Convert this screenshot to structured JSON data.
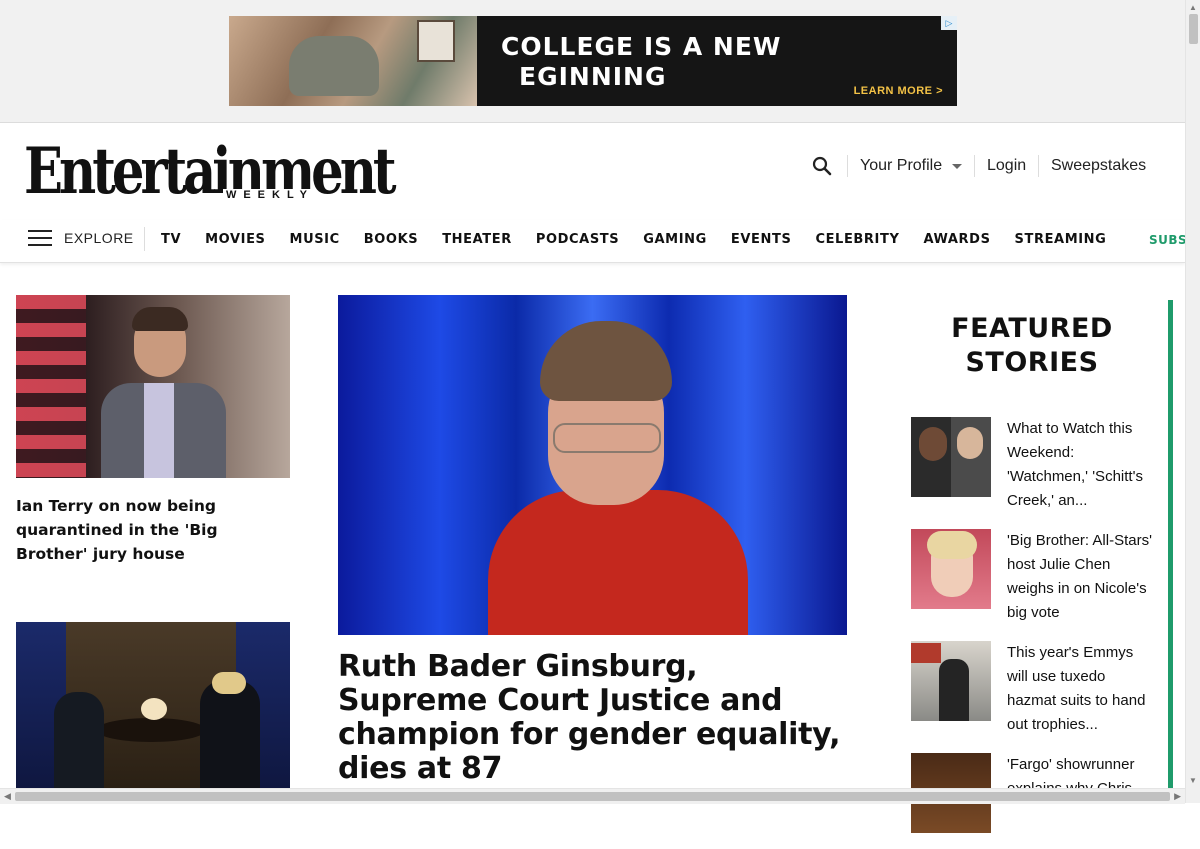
{
  "ad": {
    "headline_line1": "COLLEGE IS A NEW",
    "headline_line2": "EGINNING",
    "cta": "LEARN MORE >",
    "choices_icon": "adchoices-icon"
  },
  "header": {
    "logo_main": "Entertainment",
    "logo_sub": "WEEKLY",
    "search_icon": "search-icon",
    "profile_label": "Your Profile",
    "login_label": "Login",
    "sweepstakes_label": "Sweepstakes"
  },
  "nav": {
    "explore_label": "EXPLORE",
    "items": [
      "TV",
      "MOVIES",
      "MUSIC",
      "BOOKS",
      "THEATER",
      "PODCASTS",
      "GAMING",
      "EVENTS",
      "CELEBRITY",
      "AWARDS",
      "STREAMING"
    ],
    "subscribe_label": "SUBSCRIBE",
    "accent_color": "#1f9b6b"
  },
  "left_column": {
    "stories": [
      {
        "headline": "Ian Terry on now being quarantined in the 'Big Brother' jury house"
      }
    ]
  },
  "main": {
    "headline": "Ruth Bader Ginsburg, Supreme Court Justice and champion for gender equality, dies at 87"
  },
  "featured": {
    "title": "FEATURED STORIES",
    "items": [
      {
        "text": "What to Watch this Weekend: 'Watchmen,' 'Schitt's Creek,' an..."
      },
      {
        "text": "'Big Brother: All-Stars' host Julie Chen weighs in on Nicole's big vote"
      },
      {
        "text": "This year's Emmys will use tuxedo hazmat suits to hand out trophies..."
      },
      {
        "text": "'Fargo' showrunner explains why Chris"
      }
    ]
  }
}
